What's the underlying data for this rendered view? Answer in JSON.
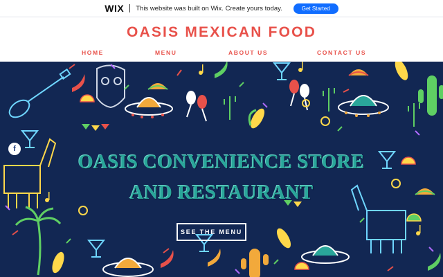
{
  "wix_banner": {
    "logo": "WIX",
    "message": "This website was built on Wix. Create yours today.",
    "cta": "Get Started"
  },
  "header": {
    "title": "OASIS MEXICAN FOOD",
    "nav": [
      {
        "label": "HOME"
      },
      {
        "label": "MENU"
      },
      {
        "label": "ABOUT US"
      },
      {
        "label": "CONTACT US"
      }
    ]
  },
  "hero": {
    "line1": "OASIS CONVENIENCE STORE",
    "line2": "AND RESTAURANT",
    "button": "SEE THE MENU",
    "social_icon": "facebook-icon"
  },
  "colors": {
    "brand_red": "#e8514a",
    "hero_bg": "#122753",
    "hero_text": "#2aa69a",
    "wix_blue": "#116dff"
  }
}
